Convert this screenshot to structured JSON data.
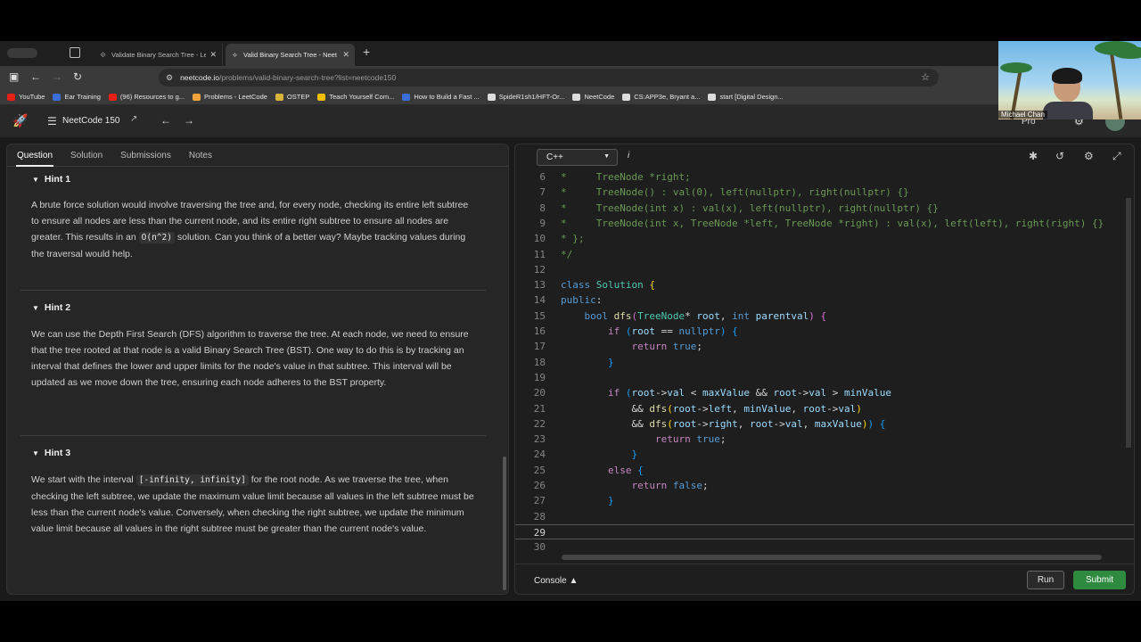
{
  "browser": {
    "tabs": [
      {
        "title": "Validate Binary Search Tree - Le",
        "active": false
      },
      {
        "title": "Valid Binary Search Tree - Neet",
        "active": true
      }
    ],
    "url_host": "neetcode.io",
    "url_path": "/problems/valid-binary-search-tree?list=neetcode150",
    "bookmarks": [
      {
        "label": "YouTube",
        "color": "#e62117"
      },
      {
        "label": "Ear Training",
        "color": "#3a6fd8"
      },
      {
        "label": "(96) Resources to g...",
        "color": "#e62117"
      },
      {
        "label": "Problems - LeetCode",
        "color": "#f0a33a"
      },
      {
        "label": "OSTEP",
        "color": "#d8b43a"
      },
      {
        "label": "Teach Yourself Com...",
        "color": "#f0c000"
      },
      {
        "label": "How to Build a Fast ...",
        "color": "#3a6fd8"
      },
      {
        "label": "SpideR1sh1/HFT-Or...",
        "color": "#dddddd"
      },
      {
        "label": "NeetCode",
        "color": "#dddddd"
      },
      {
        "label": "CS:APP3e, Bryant a...",
        "color": "#dddddd"
      },
      {
        "label": "start [Digital Design...",
        "color": "#dddddd"
      }
    ]
  },
  "header": {
    "title": "NeetCode 150",
    "pro_label": "Pro"
  },
  "left_tabs": [
    "Question",
    "Solution",
    "Submissions",
    "Notes"
  ],
  "hints": [
    {
      "title": "Hint 1",
      "parts": [
        "A brute force solution would involve traversing the tree and, for every node, checking its entire left subtree to ensure all nodes are less than the current node, and its entire right subtree to ensure all nodes are greater. This results in an ",
        "O(n^2)",
        " solution. Can you think of a better way? Maybe tracking values during the traversal would help."
      ]
    },
    {
      "title": "Hint 2",
      "parts": [
        "We can use the Depth First Search (DFS) algorithm to traverse the tree. At each node, we need to ensure that the tree rooted at that node is a valid Binary Search Tree (BST). One way to do this is by tracking an interval that defines the lower and upper limits for the node's value in that subtree. This interval will be updated as we move down the tree, ensuring each node adheres to the BST property."
      ]
    },
    {
      "title": "Hint 3",
      "parts": [
        "We start with the interval ",
        "[-infinity, infinity]",
        " for the root node. As we traverse the tree, when checking the left subtree, we update the maximum value limit because all values in the left subtree must be less than the current node's value. Conversely, when checking the right subtree, we update the minimum value limit because all values in the right subtree must be greater than the current node's value."
      ]
    }
  ],
  "editor": {
    "language": "C++",
    "info_label": "i",
    "line_numbers": [
      "6",
      "7",
      "8",
      "9",
      "10",
      "11",
      "12",
      "13",
      "14",
      "15",
      "16",
      "17",
      "18",
      "19",
      "20",
      "21",
      "22",
      "23",
      "24",
      "25",
      "26",
      "27",
      "28",
      "29",
      "30"
    ],
    "current_line": "29",
    "console_label": "Console",
    "run_label": "Run",
    "submit_label": "Submit"
  },
  "webcam": {
    "name": "Michael Chan"
  }
}
